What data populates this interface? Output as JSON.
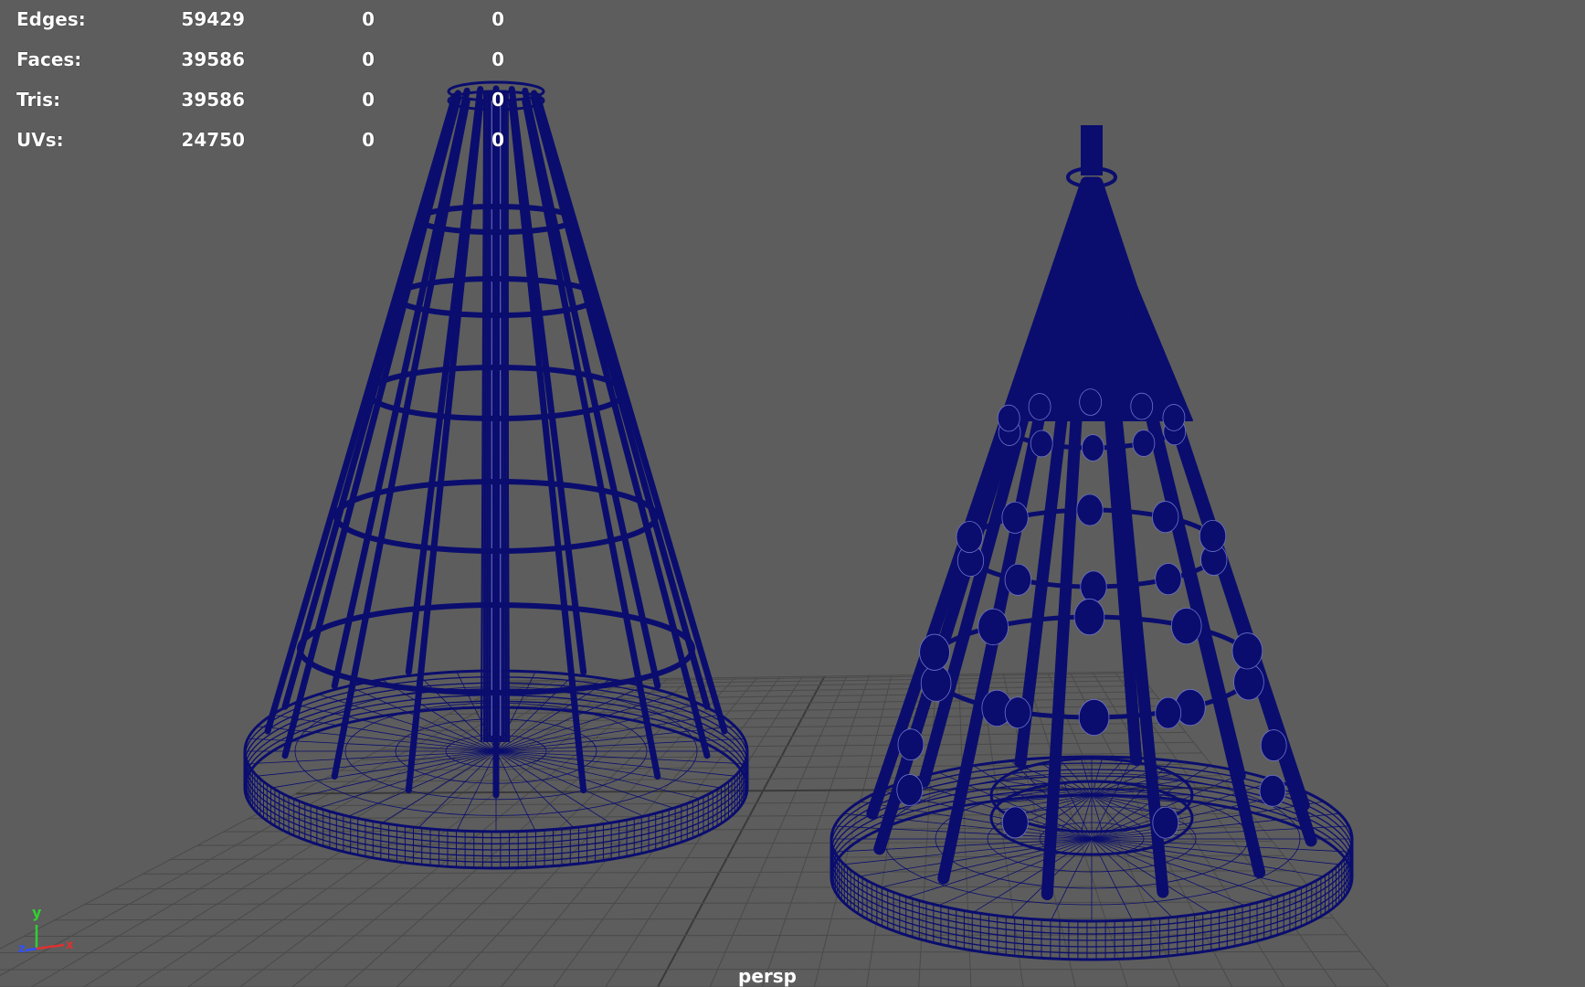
{
  "app": {
    "view": "3D perspective viewport"
  },
  "heads_up_display": {
    "rows": [
      {
        "label": "Edges:",
        "values": [
          "59429",
          "0",
          "0"
        ]
      },
      {
        "label": "Faces:",
        "values": [
          "39586",
          "0",
          "0"
        ]
      },
      {
        "label": "Tris:",
        "values": [
          "39586",
          "0",
          "0"
        ]
      },
      {
        "label": "UVs:",
        "values": [
          "24750",
          "0",
          "0"
        ]
      }
    ]
  },
  "camera": {
    "name": "persp"
  },
  "axis_gizmo": {
    "y_label": "y",
    "z_label": "z",
    "x_label": "x",
    "x_color": "#e03030",
    "y_color": "#30d030",
    "z_color": "#3050ff"
  },
  "colors": {
    "background": "#5d5d5d",
    "grid": "#4a4a4a",
    "grid_axis": "#3a3a3a",
    "wireframe": "#0a0d6e",
    "hud_text": "#ffffff"
  },
  "objects": [
    {
      "name": "playground-cone-rope-net",
      "display": "wireframe"
    },
    {
      "name": "playground-teepee-with-balls",
      "display": "wireframe"
    }
  ]
}
